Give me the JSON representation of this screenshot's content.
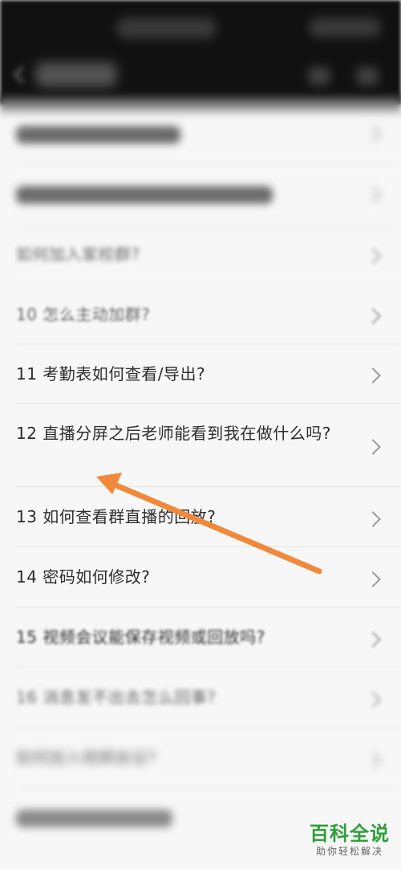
{
  "faq": {
    "items": [
      {
        "label": "如何加入家校群?"
      },
      {
        "label": "10 怎么主动加群?"
      },
      {
        "label": "11 考勤表如何查看/导出?"
      },
      {
        "label": "12 直播分屏之后老师能看到我在做什么吗?"
      },
      {
        "label": "13 如何查看群直播的回放?"
      },
      {
        "label": "14 密码如何修改?"
      },
      {
        "label": "15 视频会议能保存视频或回放吗?"
      },
      {
        "label": "16 消息发不出去怎么回事?"
      },
      {
        "label": "如何加入视频会议?"
      }
    ]
  },
  "watermark": {
    "title": "百科全说",
    "subtitle": "助你轻松解决"
  },
  "colors": {
    "arrow": "#f2893a",
    "watermark": "#2f9f3b"
  }
}
